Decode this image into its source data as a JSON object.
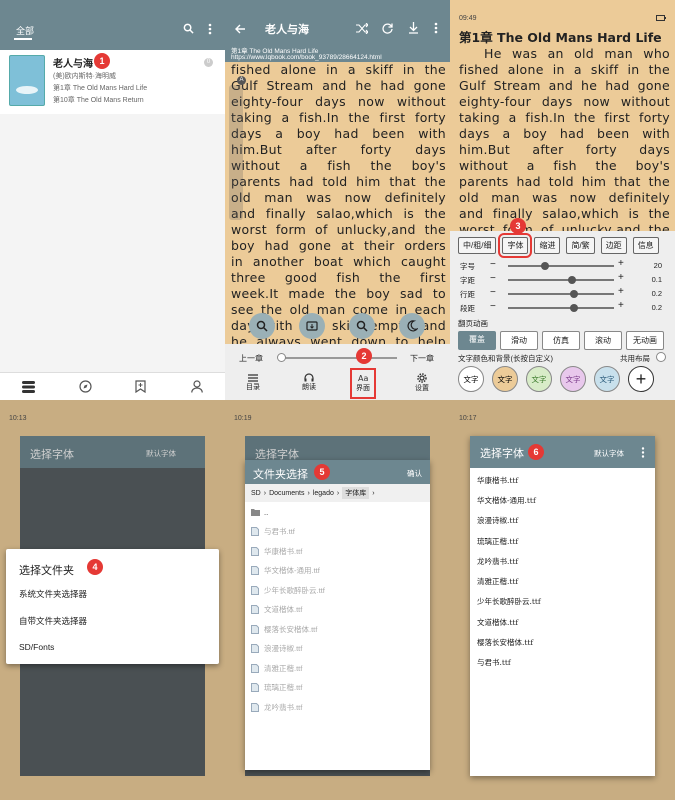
{
  "shelf": {
    "tab_all": "全部",
    "book": {
      "title": "老人与海",
      "author": "(美)欧内斯特·海明威",
      "read_chapter": "第1章 The Old Mans Hard Life",
      "latest_chapter": "第10章 The Old Mans Return",
      "unread": "0"
    }
  },
  "reader": {
    "title": "老人与海",
    "chapter_title": "第1章 The Old Mans Hard Life",
    "url": "https://www.lqbook.com/book_93789/28664124.html",
    "prev_chapter": "上一章",
    "next_chapter": "下一章",
    "menu": [
      "目录",
      "朗读",
      "界面",
      "设置"
    ],
    "text": "fished alone in a skiff in the Gulf Stream and he had gone eighty-four days now without taking a fish.In the first forty days a boy had been with him.But after forty days without a fish the boy's parents had told him that the old man was now definitely and finally salao,which is the worst form of unlucky,and the boy had gone at their orders in another boat which caught three good fish the first week.It made the boy sad to see the old man come in each day with his skiff empty and he always went down to help him carry either the coiled lines or the gaff and harpoon and"
  },
  "style_panel": {
    "time": "09:49",
    "chapter_title": "第1章 The Old Mans Hard Life",
    "text": "He was an old man who fished alone in a skiff in the Gulf Stream and he had gone eighty-four days now without taking a fish.In the first forty days a boy had been with him.But after forty days without a fish the boy's parents had told him that the old man was now definitely and finally salao,which is the worst form of unlucky,and the boy had gone at their orders in",
    "top_buttons": [
      "中/粗/细",
      "字体",
      "缩进",
      "简/繁",
      "边距",
      "信息"
    ],
    "sliders": [
      {
        "label": "字号",
        "value": "20",
        "pos": 0.35
      },
      {
        "label": "字距",
        "value": "0.1",
        "pos": 0.6
      },
      {
        "label": "行距",
        "value": "0.2",
        "pos": 0.62
      },
      {
        "label": "段距",
        "value": "0.2",
        "pos": 0.62
      }
    ],
    "page_anim_label": "翻页动画",
    "page_anims": [
      "覆盖",
      "滑动",
      "仿真",
      "滚动",
      "无动画"
    ],
    "color_label": "文字颜色和背景(长按自定义)",
    "share_layout": "共用布局",
    "swatches": [
      {
        "label": "文字",
        "bg": "#ffffff",
        "fg": "#000000"
      },
      {
        "label": "文字",
        "bg": "#eccb98",
        "fg": "#000000"
      },
      {
        "label": "文字",
        "bg": "#d8ecc8",
        "fg": "#3a7a2a"
      },
      {
        "label": "文字",
        "bg": "#e8c8ec",
        "fg": "#7a3a8a"
      },
      {
        "label": "文字",
        "bg": "#c8e0ec",
        "fg": "#2a5a7a"
      }
    ]
  },
  "select_font_dialog": {
    "title": "选择字体",
    "default_font": "默认字体"
  },
  "select_folder_dialog": {
    "title": "选择文件夹",
    "items": [
      "系统文件夹选择器",
      "自带文件夹选择器",
      "SD/Fonts"
    ]
  },
  "folder_chooser": {
    "title": "文件夹选择",
    "confirm": "确认",
    "crumbs": [
      "SD",
      "Documents",
      "legado",
      "字体库"
    ],
    "parent": "..",
    "files": [
      "与君书.ttf",
      "华康楷书.ttf",
      "华文楷体-通用.ttf",
      "少年长歌醉卧云.ttf",
      "文道楷体.ttf",
      "樱落长安楷体.ttf",
      "浪漫诗椒.ttf",
      "清雅正楷.ttf",
      "琉璃正楷.ttf",
      "龙吟翡书.ttf"
    ]
  },
  "font_list": {
    "title": "选择字体",
    "default_font": "默认字体",
    "fonts": [
      "华康楷书.ttf",
      "华文楷体-通用.ttf",
      "浪漫诗椒.ttf",
      "琉璃正楷.ttf",
      "龙吟翡书.ttf",
      "清雅正楷.ttf",
      "少年长歌醉卧云.ttf",
      "文道楷体.ttf",
      "樱落长安楷体.ttf",
      "与君书.ttf"
    ]
  },
  "times": {
    "p4": "10:13",
    "p5": "10:19",
    "p6": "10:17"
  },
  "badges": [
    "1",
    "2",
    "3",
    "4",
    "5",
    "6"
  ],
  "colors": {
    "accent": "#e53935",
    "toolbar": "#6d8790",
    "paper": "#eccb98",
    "panel": "#f0f0f0"
  }
}
